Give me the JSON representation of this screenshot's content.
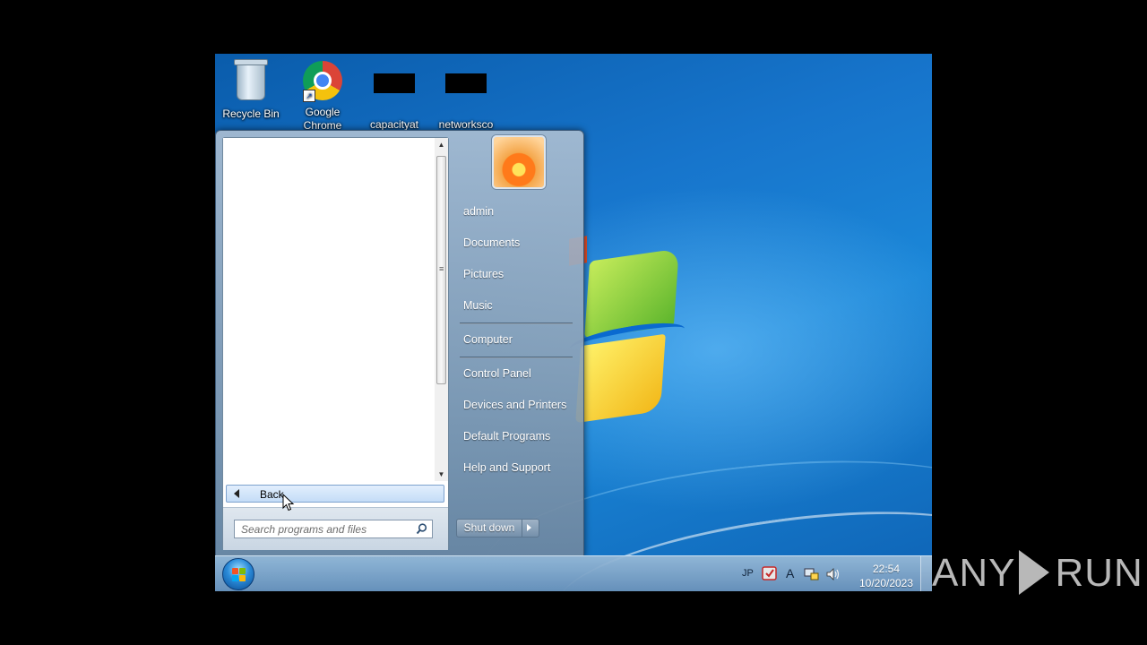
{
  "desktop": {
    "icons": [
      {
        "label": "Recycle Bin",
        "icon": "recycle-bin-icon"
      },
      {
        "label": "Google Chrome",
        "icon": "chrome-icon"
      },
      {
        "label": "capacityat",
        "icon": "file-icon"
      },
      {
        "label": "networksco",
        "icon": "file-icon"
      }
    ]
  },
  "start_menu": {
    "back_label": "Back",
    "search_placeholder": "Search programs and files",
    "user_name": "admin",
    "right_items": {
      "documents": "Documents",
      "pictures": "Pictures",
      "music": "Music",
      "computer": "Computer",
      "control_panel": "Control Panel",
      "devices_printers": "Devices and Printers",
      "default_programs": "Default Programs",
      "help_support": "Help and Support"
    },
    "shutdown_label": "Shut down"
  },
  "taskbar": {
    "language": "JP",
    "ime_indicator": "A",
    "time": "22:54",
    "date": "10/20/2023"
  },
  "watermark": {
    "left": "ANY",
    "right": "RUN"
  },
  "colors": {
    "desktop_blue": "#1775cc",
    "start_menu_glass": "#8aa3bb",
    "taskbar": "#7fa6cc"
  }
}
